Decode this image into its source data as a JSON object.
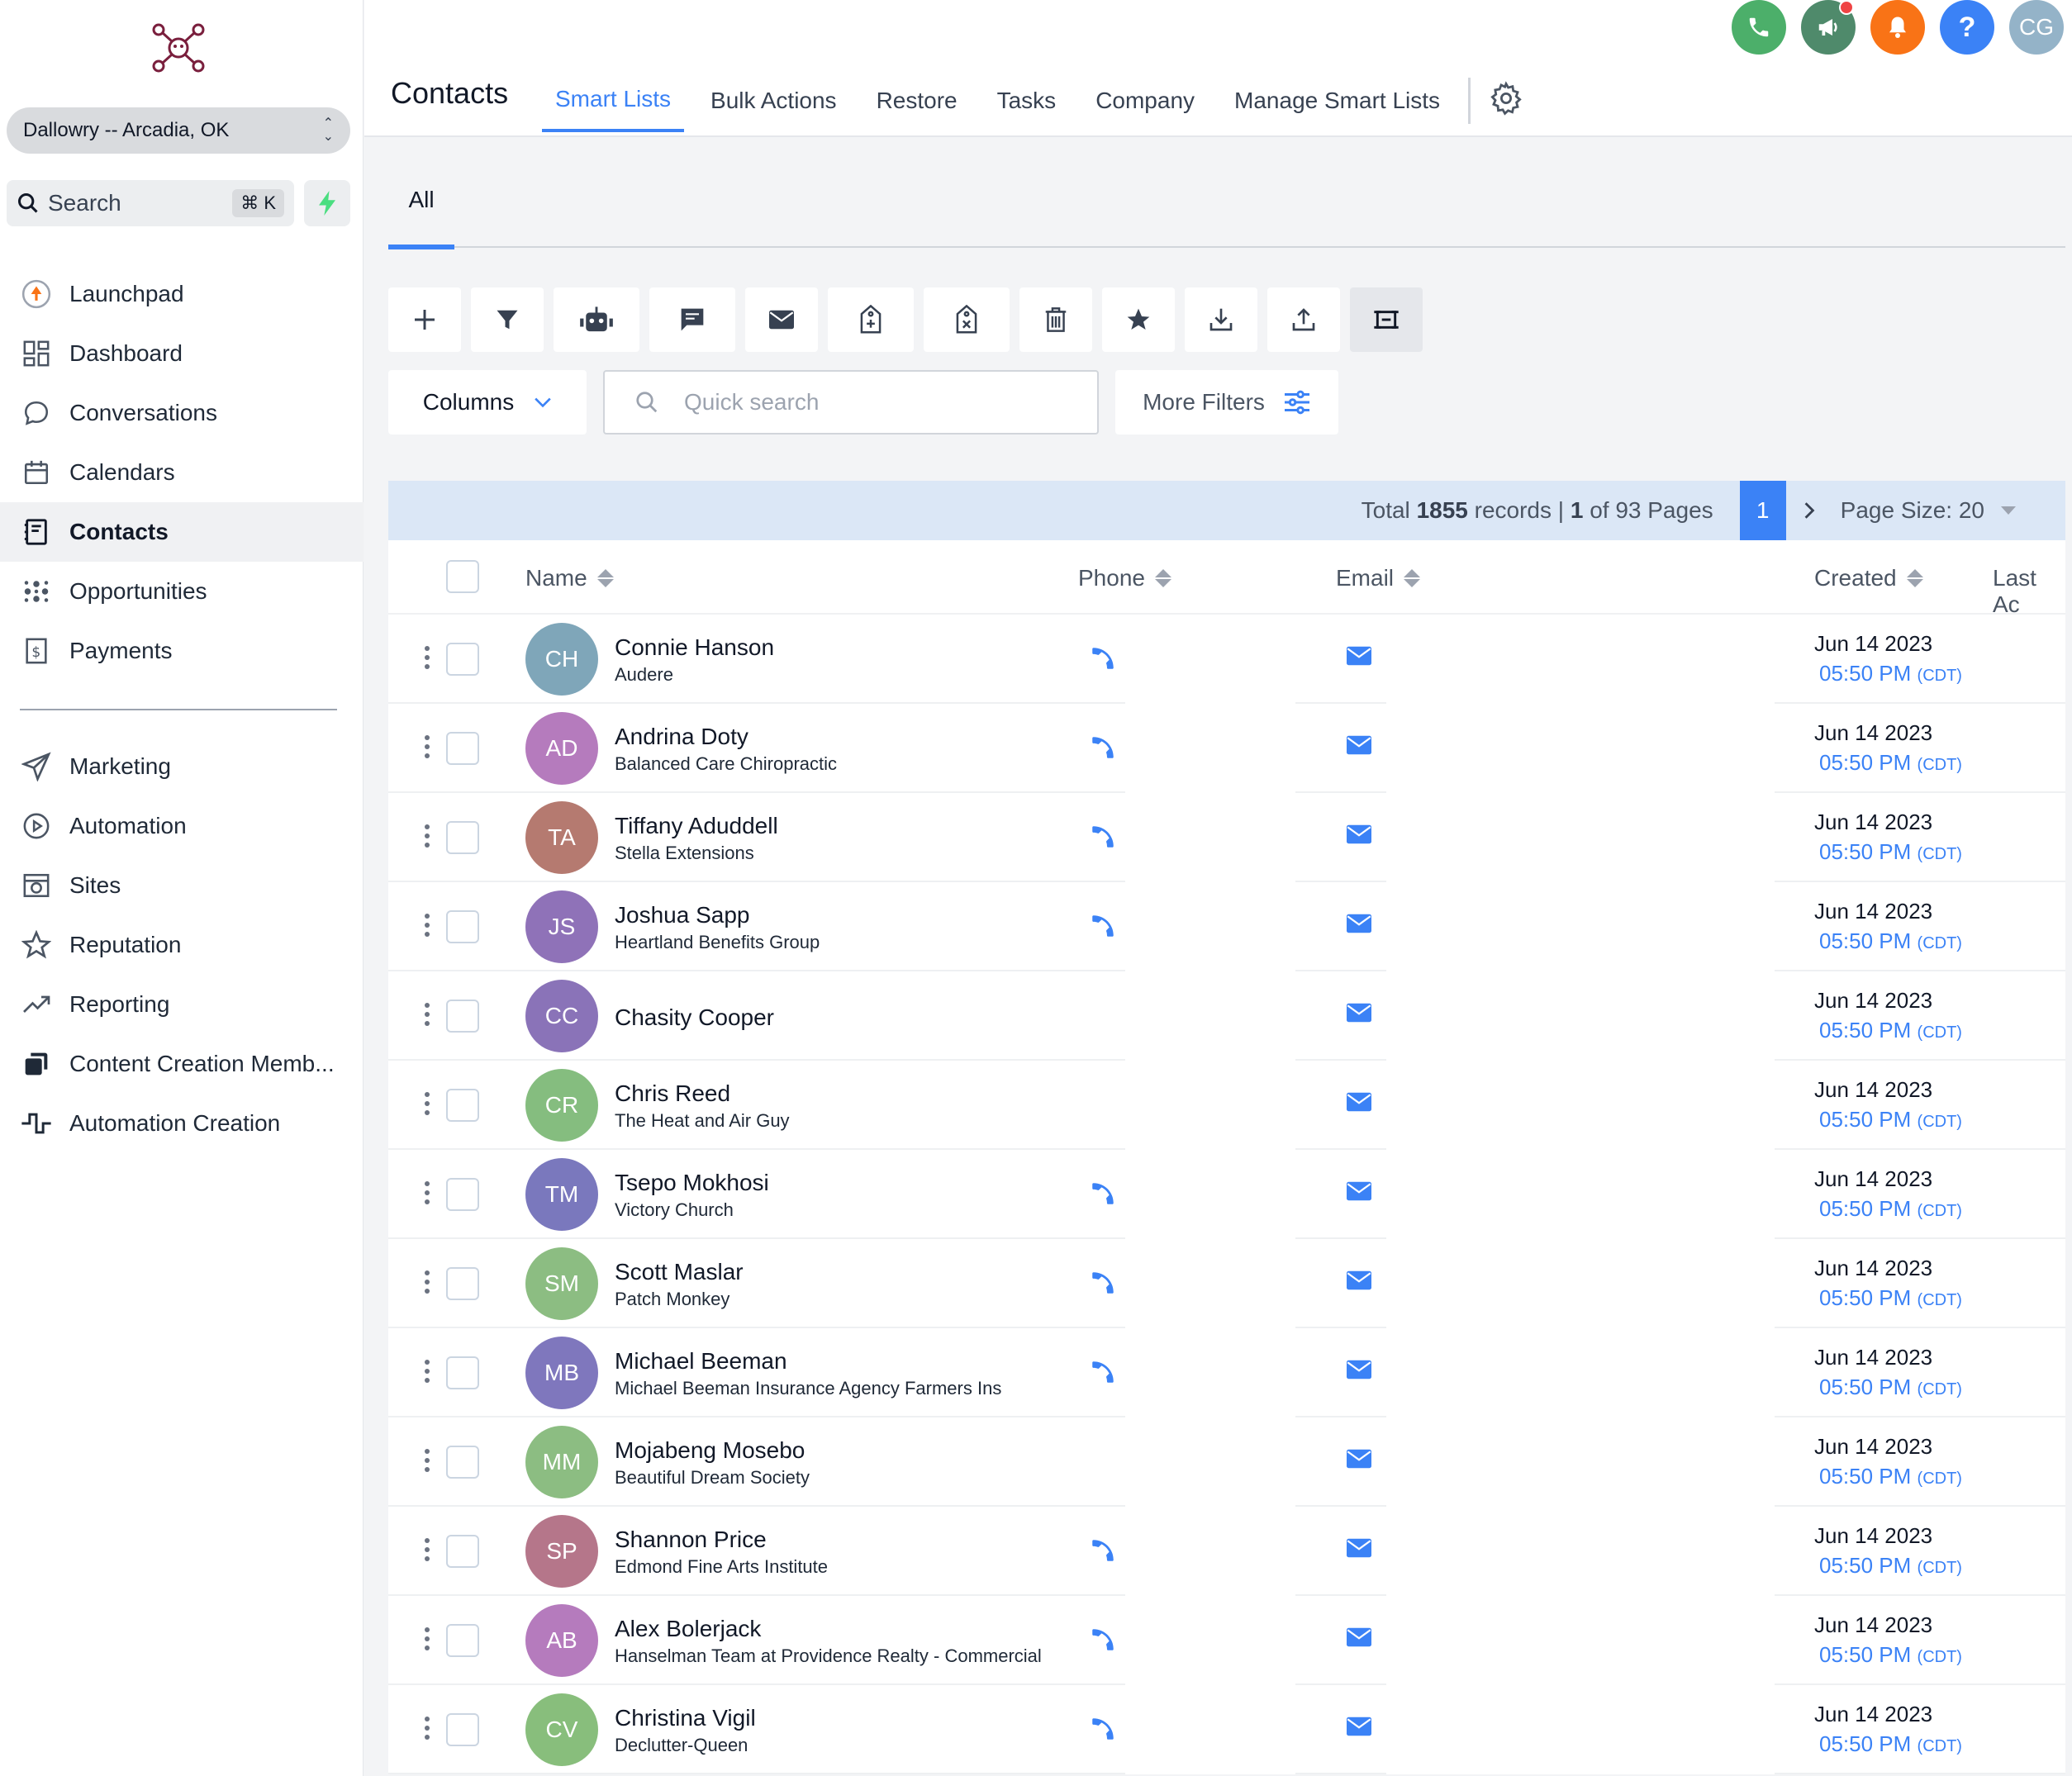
{
  "sidebar": {
    "location": "Dallowry -- Arcadia, OK",
    "search_label": "Search",
    "search_shortcut": "⌘ K",
    "items_top": [
      {
        "label": "Launchpad",
        "icon": "launchpad-icon"
      },
      {
        "label": "Dashboard",
        "icon": "dashboard-icon"
      },
      {
        "label": "Conversations",
        "icon": "chat-icon"
      },
      {
        "label": "Calendars",
        "icon": "calendar-icon"
      },
      {
        "label": "Contacts",
        "icon": "contacts-icon",
        "active": true
      },
      {
        "label": "Opportunities",
        "icon": "opportunities-icon"
      },
      {
        "label": "Payments",
        "icon": "payments-icon"
      }
    ],
    "items_bottom": [
      {
        "label": "Marketing",
        "icon": "send-icon"
      },
      {
        "label": "Automation",
        "icon": "automation-icon"
      },
      {
        "label": "Sites",
        "icon": "sites-icon"
      },
      {
        "label": "Reputation",
        "icon": "star-icon"
      },
      {
        "label": "Reporting",
        "icon": "trend-icon"
      },
      {
        "label": "Content Creation Memb...",
        "icon": "copy-icon"
      },
      {
        "label": "Automation Creation",
        "icon": "pulse-icon"
      }
    ]
  },
  "header": {
    "title": "Contacts",
    "tabs": [
      "Smart Lists",
      "Bulk Actions",
      "Restore",
      "Tasks",
      "Company",
      "Manage Smart Lists"
    ],
    "active_tab": "Smart Lists",
    "avatar_initials": "CG",
    "help_label": "?"
  },
  "colors": {
    "accent": "#3b82f6",
    "phone_btn": "#4caf6a",
    "megaphone_btn": "#4f8a6b",
    "bell_btn": "#f97316",
    "help_btn": "#3b82f6",
    "user_btn": "#94b3c8"
  },
  "subtabs": [
    "All"
  ],
  "toolbar": {
    "icons": [
      "add-icon",
      "filter-icon",
      "robot-icon",
      "sms-icon",
      "email-icon",
      "add-tag-icon",
      "remove-tag-icon",
      "delete-icon",
      "star-icon",
      "import-icon",
      "export-icon",
      "merge-icon"
    ]
  },
  "filters": {
    "columns_label": "Columns",
    "search_placeholder": "Quick search",
    "more_filters_label": "More Filters"
  },
  "pagination": {
    "total_prefix": "Total",
    "total": "1855",
    "records_label": "records |",
    "current": "1",
    "of_label": "of 93 Pages",
    "page_btn": "1",
    "page_size_label": "Page Size: 20"
  },
  "table": {
    "columns": {
      "name": "Name",
      "phone": "Phone",
      "email": "Email",
      "created": "Created",
      "last": "Last Ac"
    },
    "rows": [
      {
        "initials": "CH",
        "name": "Connie Hanson",
        "company": "Audere",
        "color": "#7fa6b9",
        "phone": true,
        "date": "Jun 14 2023",
        "time": "05:50 PM",
        "tz": "(CDT)"
      },
      {
        "initials": "AD",
        "name": "Andrina Doty",
        "company": "Balanced Care Chiropractic",
        "color": "#b57bbd",
        "phone": true,
        "date": "Jun 14 2023",
        "time": "05:50 PM",
        "tz": "(CDT)"
      },
      {
        "initials": "TA",
        "name": "Tiffany Aduddell",
        "company": "Stella Extensions",
        "color": "#b57a70",
        "phone": true,
        "date": "Jun 14 2023",
        "time": "05:50 PM",
        "tz": "(CDT)"
      },
      {
        "initials": "JS",
        "name": "Joshua Sapp",
        "company": "Heartland Benefits Group",
        "color": "#8f72b8",
        "phone": true,
        "date": "Jun 14 2023",
        "time": "05:50 PM",
        "tz": "(CDT)"
      },
      {
        "initials": "CC",
        "name": "Chasity Cooper",
        "company": "",
        "color": "#8a73b8",
        "phone": false,
        "date": "Jun 14 2023",
        "time": "05:50 PM",
        "tz": "(CDT)"
      },
      {
        "initials": "CR",
        "name": "Chris Reed",
        "company": "The Heat and Air Guy",
        "color": "#85bd7f",
        "phone": false,
        "date": "Jun 14 2023",
        "time": "05:50 PM",
        "tz": "(CDT)"
      },
      {
        "initials": "TM",
        "name": "Tsepo Mokhosi",
        "company": "Victory Church",
        "color": "#7a78bd",
        "phone": true,
        "date": "Jun 14 2023",
        "time": "05:50 PM",
        "tz": "(CDT)"
      },
      {
        "initials": "SM",
        "name": "Scott Maslar",
        "company": "Patch Monkey",
        "color": "#8cbd82",
        "phone": true,
        "date": "Jun 14 2023",
        "time": "05:50 PM",
        "tz": "(CDT)"
      },
      {
        "initials": "MB",
        "name": "Michael Beeman",
        "company": "Michael Beeman Insurance Agency Farmers Ins",
        "color": "#7f77bd",
        "phone": true,
        "date": "Jun 14 2023",
        "time": "05:50 PM",
        "tz": "(CDT)"
      },
      {
        "initials": "MM",
        "name": "Mojabeng Mosebo",
        "company": "Beautiful Dream Society",
        "color": "#8cbd82",
        "phone": false,
        "date": "Jun 14 2023",
        "time": "05:50 PM",
        "tz": "(CDT)"
      },
      {
        "initials": "SP",
        "name": "Shannon Price",
        "company": "Edmond Fine Arts Institute",
        "color": "#b5768a",
        "phone": true,
        "date": "Jun 14 2023",
        "time": "05:50 PM",
        "tz": "(CDT)"
      },
      {
        "initials": "AB",
        "name": "Alex Bolerjack",
        "company": "Hanselman Team at Providence Realty - Commercial",
        "color": "#b57bbd",
        "phone": true,
        "date": "Jun 14 2023",
        "time": "05:50 PM",
        "tz": "(CDT)"
      },
      {
        "initials": "CV",
        "name": "Christina Vigil",
        "company": "Declutter-Queen",
        "color": "#88be7c",
        "phone": true,
        "date": "Jun 14 2023",
        "time": "05:50 PM",
        "tz": "(CDT)"
      }
    ]
  }
}
